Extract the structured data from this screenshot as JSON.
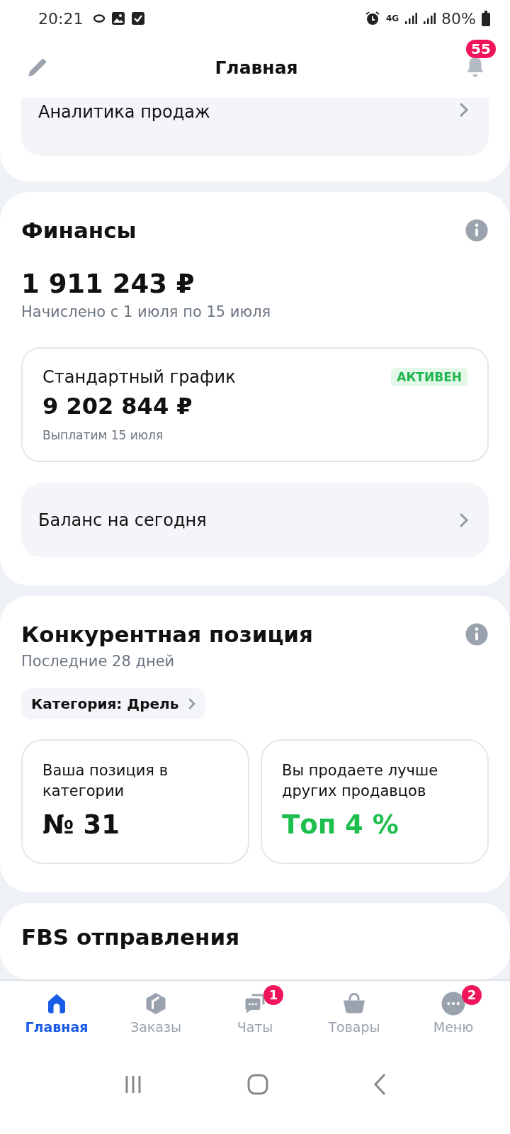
{
  "status_bar": {
    "time": "20:21",
    "network": "4G",
    "battery": "80%"
  },
  "header": {
    "title": "Главная",
    "notifications": "55"
  },
  "analytics_link": {
    "label": "Аналитика продаж"
  },
  "finance": {
    "title": "Финансы",
    "amount": "1 911 243 ₽",
    "period": "Начислено с 1 июля по 15 июля",
    "schedule": {
      "title": "Стандартный график",
      "status": "АКТИВЕН",
      "amount": "9 202 844 ₽",
      "payout": "Выплатим 15 июля"
    },
    "balance_link": {
      "label": "Баланс на сегодня"
    }
  },
  "competition": {
    "title": "Конкурентная позиция",
    "period": "Последние 28 дней",
    "category": "Категория: Дрель",
    "cards": [
      {
        "label": "Ваша позиция в категории",
        "value": "№ 31",
        "highlight": false
      },
      {
        "label": "Вы продаете лучше других продавцов",
        "value": "Топ 4 %",
        "highlight": true
      }
    ]
  },
  "next_section": {
    "title": "FBS отправления"
  },
  "tabs": [
    {
      "label": "Главная",
      "selected": true
    },
    {
      "label": "Заказы",
      "selected": false
    },
    {
      "label": "Чаты",
      "selected": false,
      "badge": "1"
    },
    {
      "label": "Товары",
      "selected": false
    },
    {
      "label": "Меню",
      "selected": false,
      "badge": "2"
    }
  ]
}
